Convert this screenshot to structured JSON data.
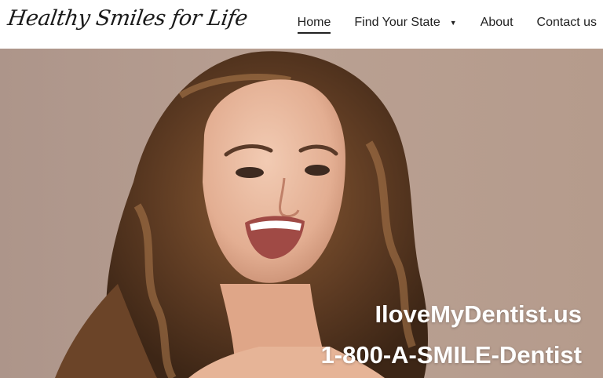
{
  "header": {
    "logo_text": "Healthy Smiles for Life"
  },
  "nav": {
    "items": [
      {
        "label": "Home",
        "active": true
      },
      {
        "label": "Find Your State",
        "dropdown": true
      },
      {
        "label": "About"
      },
      {
        "label": "Contact us"
      }
    ]
  },
  "hero": {
    "image_description_icon": "smiling-woman-photo",
    "site_url": "IloveMyDentist.us",
    "phone": "1-800-A-SMILE-Dentist",
    "background_color": "#b79f90",
    "text_color": "#ffffff"
  }
}
